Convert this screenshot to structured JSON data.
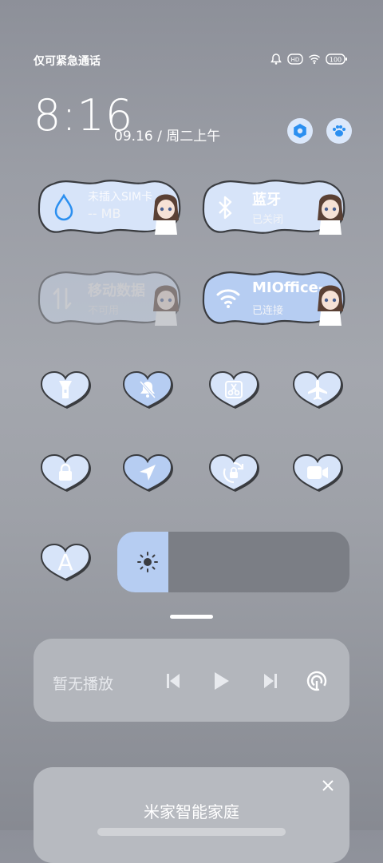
{
  "status_bar": {
    "carrier_text": "仅可紧急通话",
    "icons": [
      "alarm-icon",
      "hd-icon",
      "wifi-icon",
      "battery-icon"
    ],
    "battery_text": "100"
  },
  "header": {
    "time": "8:16",
    "date": "09.16 / 周二上午",
    "buttons": [
      "settings-icon",
      "edit-icon"
    ]
  },
  "tiles": {
    "data_usage": {
      "title": "未插入SIM卡",
      "value": "-- MB"
    },
    "bluetooth": {
      "title": "蓝牙",
      "status": "已关闭"
    },
    "mobile_data": {
      "title": "移动数据",
      "status": "不可用"
    },
    "wifi": {
      "title": "MIOffice-",
      "status": "已连接"
    }
  },
  "toggles_row1": [
    {
      "name": "flashlight",
      "icon": "flashlight-icon",
      "active": false
    },
    {
      "name": "mute",
      "icon": "bell-off-icon",
      "active": true
    },
    {
      "name": "screenshot",
      "icon": "scissors-icon",
      "active": false
    },
    {
      "name": "airplane",
      "icon": "airplane-icon",
      "active": false
    }
  ],
  "toggles_row2": [
    {
      "name": "lock",
      "icon": "lock-icon",
      "active": false
    },
    {
      "name": "location",
      "icon": "location-arrow-icon",
      "active": true
    },
    {
      "name": "auto-rotate",
      "icon": "rotate-lock-icon",
      "active": false
    },
    {
      "name": "screen-record",
      "icon": "video-camera-icon",
      "active": false
    }
  ],
  "font_toggle": {
    "label": "A"
  },
  "brightness": {
    "level": 0.22
  },
  "media": {
    "title": "暂无播放",
    "controls": [
      "previous-icon",
      "play-icon",
      "next-icon",
      "cast-icon"
    ]
  },
  "smart_home": {
    "title": "米家智能家庭"
  },
  "colors": {
    "accent": "#2b8ff0",
    "tile_active": "#b6cdf2",
    "tile_inactive": "#d7e4f9"
  }
}
